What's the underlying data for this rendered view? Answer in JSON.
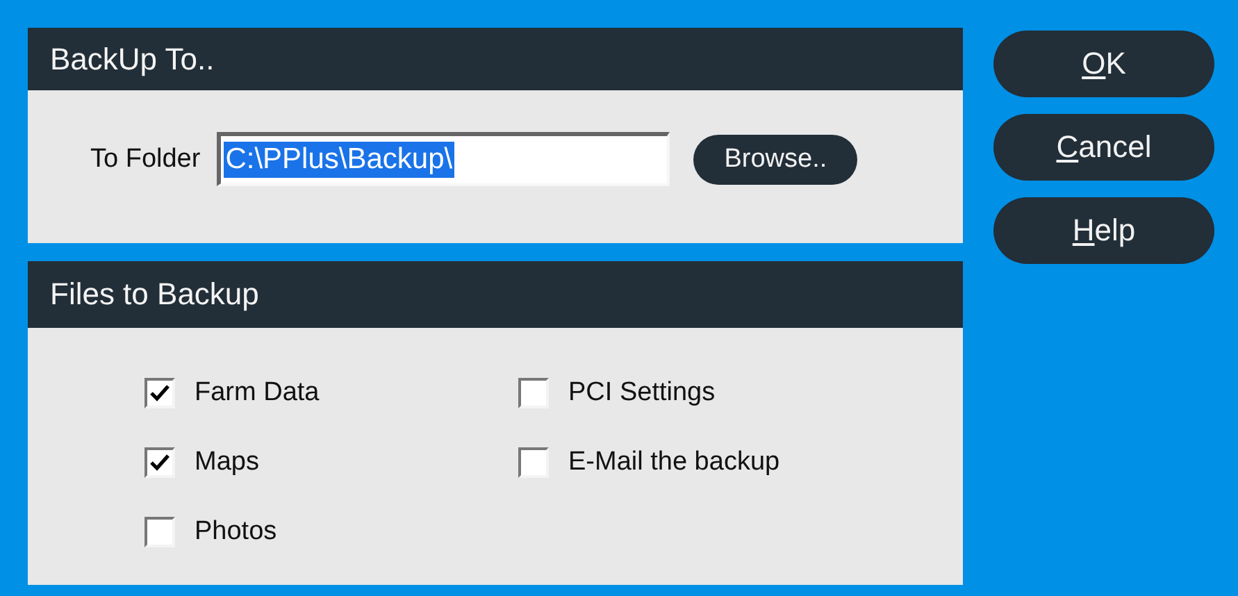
{
  "backup_to": {
    "title": "BackUp To..",
    "folder_label": "To Folder",
    "folder_value": "C:\\PPlus\\Backup\\",
    "value_selected": true,
    "browse_button": "Browse.."
  },
  "files_to_backup": {
    "title": "Files to Backup",
    "options": [
      {
        "label": "Farm Data",
        "checked": true
      },
      {
        "label": "Maps",
        "checked": true
      },
      {
        "label": "Photos",
        "checked": false
      },
      {
        "label": "PCI Settings",
        "checked": false
      },
      {
        "label": "E-Mail the backup",
        "checked": false
      }
    ]
  },
  "buttons": [
    {
      "access_key": "O",
      "rest": "K"
    },
    {
      "access_key": "C",
      "rest": "ancel"
    },
    {
      "access_key": "H",
      "rest": "elp"
    }
  ]
}
